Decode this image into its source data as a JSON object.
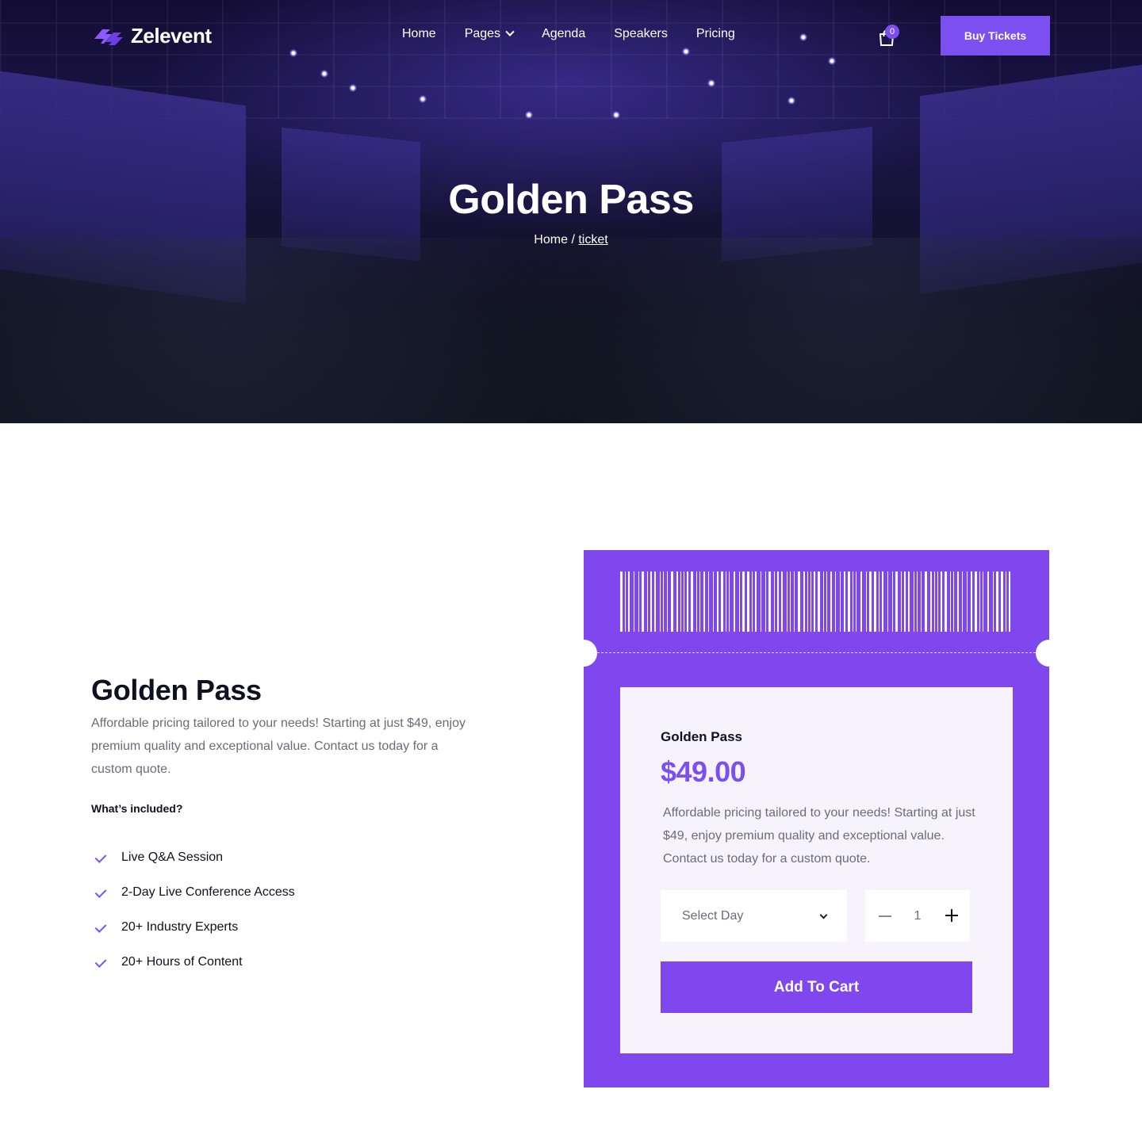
{
  "brand": {
    "name": "Zelevent",
    "accent": "#7b4ff0"
  },
  "nav": {
    "items": [
      {
        "label": "Home"
      },
      {
        "label": "Pages",
        "has_dropdown": true
      },
      {
        "label": "Agenda"
      },
      {
        "label": "Speakers"
      },
      {
        "label": "Pricing"
      }
    ],
    "cart_count": "0",
    "cta_label": "Buy Tickets"
  },
  "hero": {
    "title": "Golden Pass",
    "breadcrumb": {
      "home": "Home",
      "separator": "/",
      "current": "ticket"
    }
  },
  "details": {
    "title": "Golden Pass",
    "description": "Affordable pricing tailored to your needs! Starting at just $49, enjoy premium quality and exceptional value. Contact us today for a custom quote.",
    "included_heading": "What’s included?",
    "features": [
      "Live Q&A Session",
      "2-Day Live Conference Access",
      "20+ Industry Experts",
      "20+ Hours of Content"
    ]
  },
  "ticket": {
    "name": "Golden Pass",
    "price": "$49.00",
    "description": "Affordable pricing tailored to your needs! Starting at just $49, enjoy premium quality and exceptional value. Contact us today for a custom quote.",
    "select_placeholder": "Select Day",
    "quantity": "1",
    "add_to_cart_label": "Add To Cart",
    "card_color": "#8047ee"
  }
}
